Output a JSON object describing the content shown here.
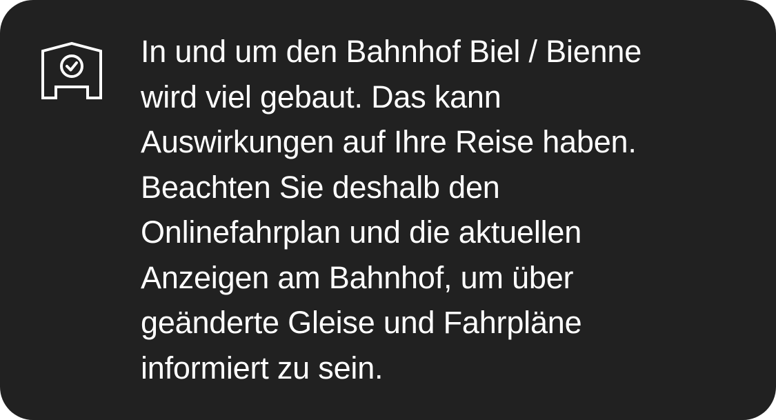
{
  "notice": {
    "icon": "station-clock-icon",
    "lines": [
      "In und um den Bahnhof Biel / Bienne",
      "wird viel gebaut. Das kann",
      "Auswirkungen auf Ihre Reise haben.",
      "Beachten Sie deshalb den",
      "Onlinefahrplan und die aktuellen",
      "Anzeigen am Bahnhof, um über",
      "geänderte Gleise und Fahrpläne",
      "informiert zu sein."
    ]
  },
  "colors": {
    "background": "#212121",
    "text": "#ffffff"
  }
}
